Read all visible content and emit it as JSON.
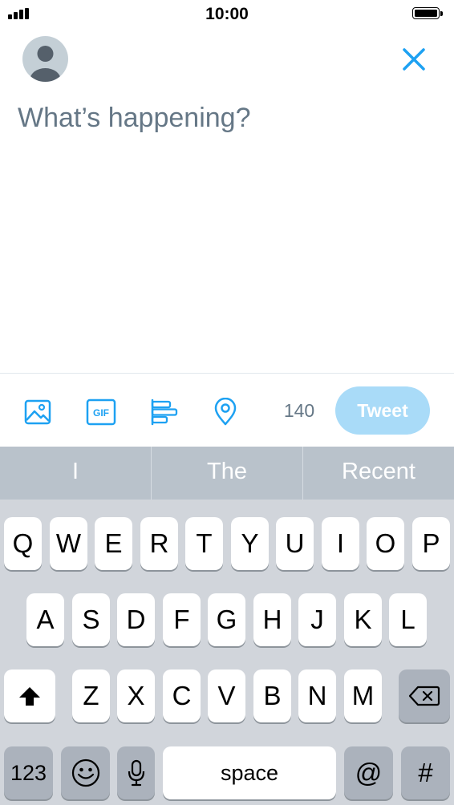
{
  "status_bar": {
    "time": "10:00"
  },
  "compose": {
    "placeholder": "What’s happening?",
    "icons": {
      "avatar": "user-avatar",
      "close": "close-icon"
    },
    "accent_color": "#1da1f2"
  },
  "toolbar": {
    "icons": [
      "image-icon",
      "gif-icon",
      "poll-icon",
      "location-icon"
    ],
    "gif_label": "GIF",
    "char_count": "140",
    "tweet_label": "Tweet",
    "tweet_button_color": "#a9dbf8"
  },
  "predictive": {
    "suggestions": [
      "I",
      "The",
      "Recent"
    ]
  },
  "keyboard": {
    "row1": [
      "Q",
      "W",
      "E",
      "R",
      "T",
      "Y",
      "U",
      "I",
      "O",
      "P"
    ],
    "row2": [
      "A",
      "S",
      "D",
      "F",
      "G",
      "H",
      "J",
      "K",
      "L"
    ],
    "row3": [
      "Z",
      "X",
      "C",
      "V",
      "B",
      "N",
      "M"
    ],
    "numbers_label": "123",
    "space_label": "space",
    "at_label": "@",
    "hash_label": "#",
    "icons": {
      "shift": "shift-icon",
      "backspace": "backspace-icon",
      "emoji": "emoji-icon",
      "mic": "microphone-icon"
    }
  }
}
